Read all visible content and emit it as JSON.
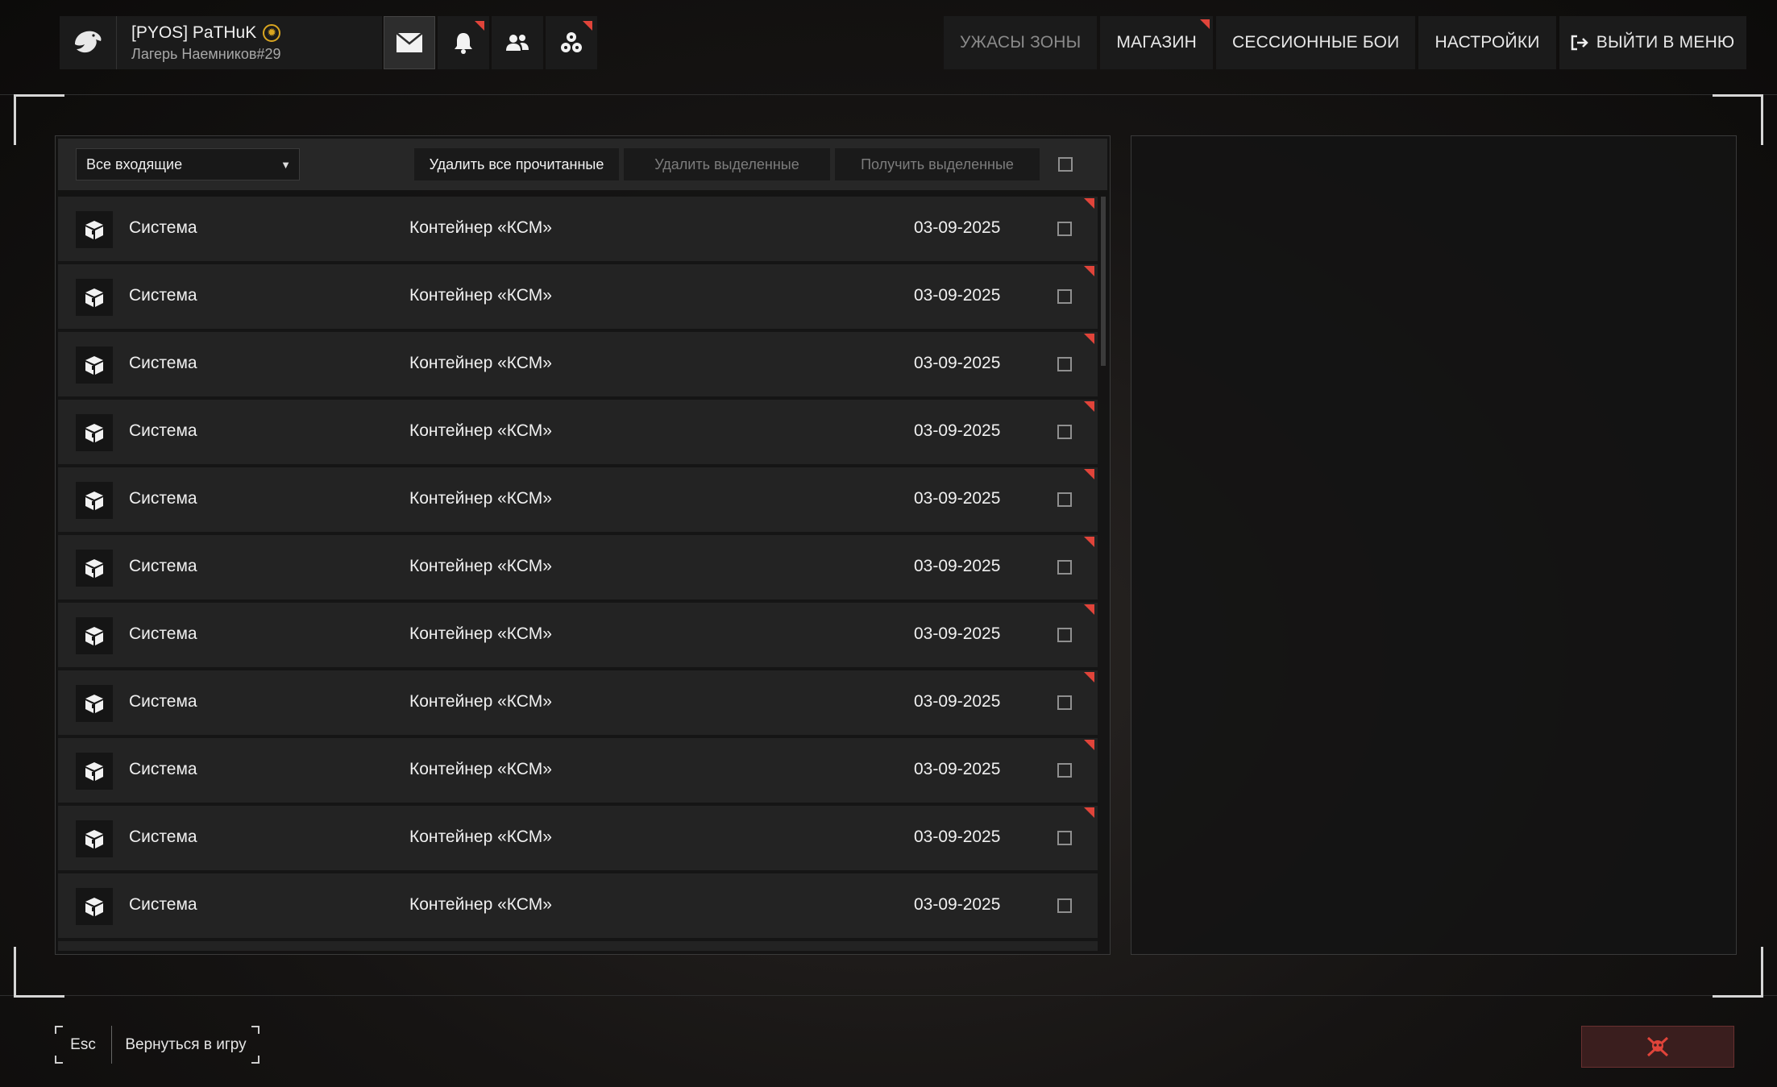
{
  "profile": {
    "name": "[PYOS] PaTHuK",
    "subtitle": "Лагерь Наемников#29",
    "icons": {
      "logo": "eagle-icon",
      "badge": "sun-badge-icon"
    }
  },
  "top_icons": [
    {
      "name": "mail-icon",
      "active": true,
      "notify": false
    },
    {
      "name": "bell-icon",
      "active": false,
      "notify": true
    },
    {
      "name": "friends-icon",
      "active": false,
      "notify": false
    },
    {
      "name": "group-icon",
      "active": false,
      "notify": true
    }
  ],
  "nav": {
    "items": [
      {
        "label": "УЖАСЫ ЗОНЫ",
        "dim": true,
        "notify": false
      },
      {
        "label": "МАГАЗИН",
        "dim": false,
        "notify": true
      },
      {
        "label": "СЕССИОННЫЕ БОИ",
        "dim": false,
        "notify": false
      },
      {
        "label": "НАСТРОЙКИ",
        "dim": false,
        "notify": false
      }
    ],
    "exit_label": "ВЫЙТИ В МЕНЮ"
  },
  "mail": {
    "filter_value": "Все входящие",
    "delete_read_label": "Удалить все прочитанные",
    "delete_selected_label": "Удалить выделенные",
    "receive_selected_label": "Получить выделенные",
    "rows": [
      {
        "sender": "Система",
        "subject": "Контейнер «КСМ»",
        "date": "03-09-2025",
        "unread": true
      },
      {
        "sender": "Система",
        "subject": "Контейнер «КСМ»",
        "date": "03-09-2025",
        "unread": true
      },
      {
        "sender": "Система",
        "subject": "Контейнер «КСМ»",
        "date": "03-09-2025",
        "unread": true
      },
      {
        "sender": "Система",
        "subject": "Контейнер «КСМ»",
        "date": "03-09-2025",
        "unread": true
      },
      {
        "sender": "Система",
        "subject": "Контейнер «КСМ»",
        "date": "03-09-2025",
        "unread": true
      },
      {
        "sender": "Система",
        "subject": "Контейнер «КСМ»",
        "date": "03-09-2025",
        "unread": true
      },
      {
        "sender": "Система",
        "subject": "Контейнер «КСМ»",
        "date": "03-09-2025",
        "unread": true
      },
      {
        "sender": "Система",
        "subject": "Контейнер «КСМ»",
        "date": "03-09-2025",
        "unread": true
      },
      {
        "sender": "Система",
        "subject": "Контейнер «КСМ»",
        "date": "03-09-2025",
        "unread": true
      },
      {
        "sender": "Система",
        "subject": "Контейнер «КСМ»",
        "date": "03-09-2025",
        "unread": true
      },
      {
        "sender": "Система",
        "subject": "Контейнер «КСМ»",
        "date": "03-09-2025",
        "unread": false
      }
    ]
  },
  "footer": {
    "esc_key": "Esc",
    "back_label": "Вернуться в игру",
    "danger_icon": "skull-icon"
  },
  "colors": {
    "accent_red": "#e0443a",
    "panel": "#232323",
    "badge_gold": "#d9a520"
  }
}
